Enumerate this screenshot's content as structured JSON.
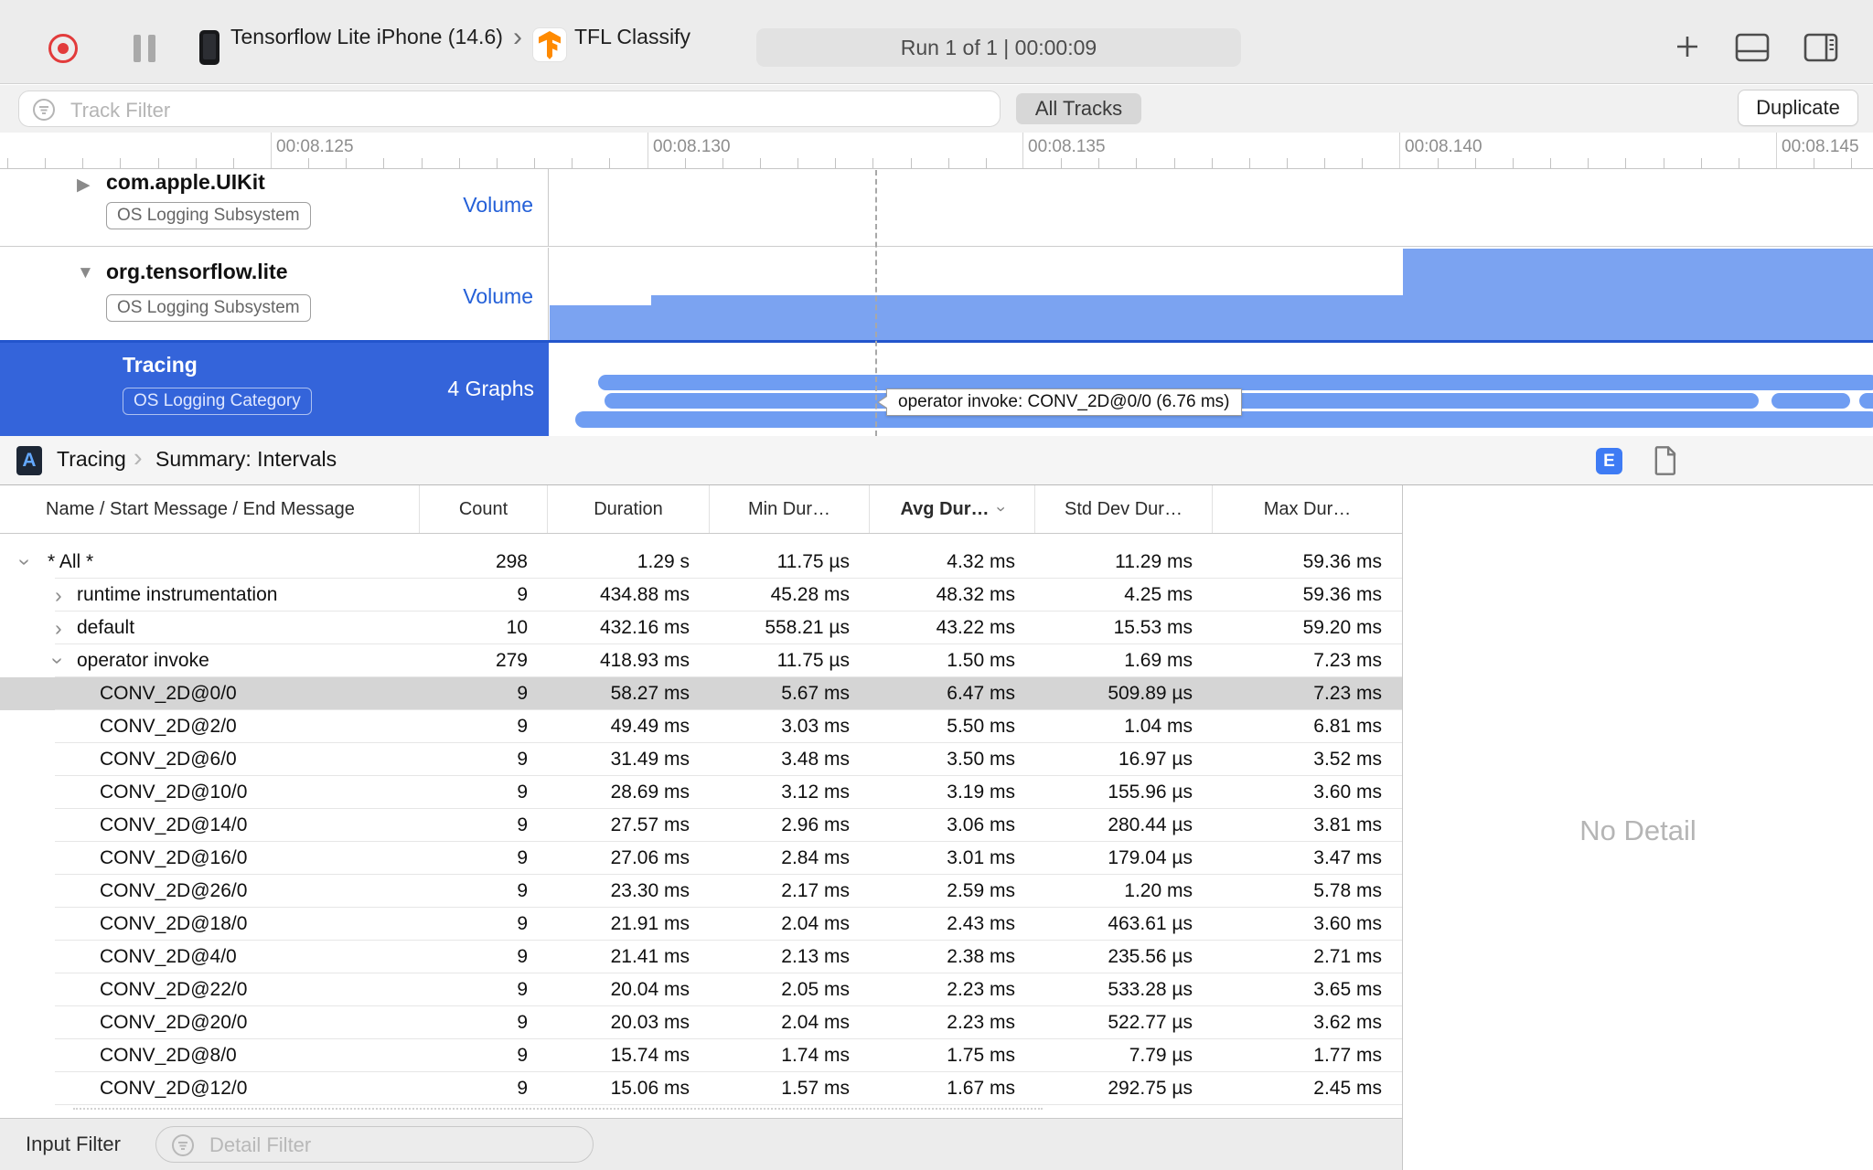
{
  "toolbar": {
    "device": "Tensorflow Lite iPhone (14.6)",
    "separator_glyph": "›",
    "target": "TFL Classify",
    "run_info": "Run 1 of 1  |  00:00:09"
  },
  "filter_bar": {
    "track_filter_placeholder": "Track Filter",
    "all_tracks_label": "All Tracks",
    "duplicate_label": "Duplicate"
  },
  "ruler": {
    "ticks": [
      "00:08.125",
      "00:08.130",
      "00:08.135",
      "00:08.140",
      "00:08.145"
    ]
  },
  "tracks": [
    {
      "name": "com.apple.UIKit",
      "badge": "OS Logging Subsystem",
      "lane_label": "Volume",
      "state": "collapsed"
    },
    {
      "name": "org.tensorflow.lite",
      "badge": "OS Logging Subsystem",
      "lane_label": "Volume",
      "state": "expanded"
    },
    {
      "name": "Tracing",
      "badge": "OS Logging Category",
      "lane_label": "4 Graphs",
      "state": "selected"
    }
  ],
  "timeline": {
    "tooltip": "operator invoke: CONV_2D@0/0 (6.76 ms)"
  },
  "colors": {
    "selection_blue": "#3464da",
    "histogram_blue": "#7ba3f1",
    "interval_blue": "#6f9df2",
    "record_red": "#e23b3b",
    "badge_blue": "#3e7bf4"
  },
  "detail": {
    "breadcrumb": [
      "Tracing",
      "Summary: Intervals"
    ],
    "breadcrumb_separator": "›",
    "inspector_badge": "E",
    "no_detail": "No Detail",
    "table": {
      "columns": [
        "Name / Start Message / End Message",
        "Count",
        "Duration",
        "Min Dur…",
        "Avg Dur…",
        "Std Dev Dur…",
        "Max Dur…"
      ],
      "sorted_column": "Avg Dur…",
      "rows": [
        {
          "name": "* All *",
          "count": "298",
          "duration": "1.29 s",
          "min": "11.75 µs",
          "avg": "4.32 ms",
          "std": "11.29 ms",
          "max": "59.36 ms",
          "level": 0,
          "disclosure": "down",
          "selected": false
        },
        {
          "name": "runtime instrumentation",
          "count": "9",
          "duration": "434.88 ms",
          "min": "45.28 ms",
          "avg": "48.32 ms",
          "std": "4.25 ms",
          "max": "59.36 ms",
          "level": 1,
          "disclosure": "right",
          "selected": false
        },
        {
          "name": "default",
          "count": "10",
          "duration": "432.16 ms",
          "min": "558.21 µs",
          "avg": "43.22 ms",
          "std": "15.53 ms",
          "max": "59.20 ms",
          "level": 1,
          "disclosure": "right",
          "selected": false
        },
        {
          "name": "operator invoke",
          "count": "279",
          "duration": "418.93 ms",
          "min": "11.75 µs",
          "avg": "1.50 ms",
          "std": "1.69 ms",
          "max": "7.23 ms",
          "level": 1,
          "disclosure": "down",
          "selected": false
        },
        {
          "name": "CONV_2D@0/0",
          "count": "9",
          "duration": "58.27 ms",
          "min": "5.67 ms",
          "avg": "6.47 ms",
          "std": "509.89 µs",
          "max": "7.23 ms",
          "level": 2,
          "disclosure": null,
          "selected": true
        },
        {
          "name": "CONV_2D@2/0",
          "count": "9",
          "duration": "49.49 ms",
          "min": "3.03 ms",
          "avg": "5.50 ms",
          "std": "1.04 ms",
          "max": "6.81 ms",
          "level": 2,
          "disclosure": null,
          "selected": false
        },
        {
          "name": "CONV_2D@6/0",
          "count": "9",
          "duration": "31.49 ms",
          "min": "3.48 ms",
          "avg": "3.50 ms",
          "std": "16.97 µs",
          "max": "3.52 ms",
          "level": 2,
          "disclosure": null,
          "selected": false
        },
        {
          "name": "CONV_2D@10/0",
          "count": "9",
          "duration": "28.69 ms",
          "min": "3.12 ms",
          "avg": "3.19 ms",
          "std": "155.96 µs",
          "max": "3.60 ms",
          "level": 2,
          "disclosure": null,
          "selected": false
        },
        {
          "name": "CONV_2D@14/0",
          "count": "9",
          "duration": "27.57 ms",
          "min": "2.96 ms",
          "avg": "3.06 ms",
          "std": "280.44 µs",
          "max": "3.81 ms",
          "level": 2,
          "disclosure": null,
          "selected": false
        },
        {
          "name": "CONV_2D@16/0",
          "count": "9",
          "duration": "27.06 ms",
          "min": "2.84 ms",
          "avg": "3.01 ms",
          "std": "179.04 µs",
          "max": "3.47 ms",
          "level": 2,
          "disclosure": null,
          "selected": false
        },
        {
          "name": "CONV_2D@26/0",
          "count": "9",
          "duration": "23.30 ms",
          "min": "2.17 ms",
          "avg": "2.59 ms",
          "std": "1.20 ms",
          "max": "5.78 ms",
          "level": 2,
          "disclosure": null,
          "selected": false
        },
        {
          "name": "CONV_2D@18/0",
          "count": "9",
          "duration": "21.91 ms",
          "min": "2.04 ms",
          "avg": "2.43 ms",
          "std": "463.61 µs",
          "max": "3.60 ms",
          "level": 2,
          "disclosure": null,
          "selected": false
        },
        {
          "name": "CONV_2D@4/0",
          "count": "9",
          "duration": "21.41 ms",
          "min": "2.13 ms",
          "avg": "2.38 ms",
          "std": "235.56 µs",
          "max": "2.71 ms",
          "level": 2,
          "disclosure": null,
          "selected": false
        },
        {
          "name": "CONV_2D@22/0",
          "count": "9",
          "duration": "20.04 ms",
          "min": "2.05 ms",
          "avg": "2.23 ms",
          "std": "533.28 µs",
          "max": "3.65 ms",
          "level": 2,
          "disclosure": null,
          "selected": false
        },
        {
          "name": "CONV_2D@20/0",
          "count": "9",
          "duration": "20.03 ms",
          "min": "2.04 ms",
          "avg": "2.23 ms",
          "std": "522.77 µs",
          "max": "3.62 ms",
          "level": 2,
          "disclosure": null,
          "selected": false
        },
        {
          "name": "CONV_2D@8/0",
          "count": "9",
          "duration": "15.74 ms",
          "min": "1.74 ms",
          "avg": "1.75 ms",
          "std": "7.79 µs",
          "max": "1.77 ms",
          "level": 2,
          "disclosure": null,
          "selected": false
        },
        {
          "name": "CONV_2D@12/0",
          "count": "9",
          "duration": "15.06 ms",
          "min": "1.57 ms",
          "avg": "1.67 ms",
          "std": "292.75 µs",
          "max": "2.45 ms",
          "level": 2,
          "disclosure": null,
          "selected": false
        }
      ]
    }
  },
  "bottom_bar": {
    "input_filter_label": "Input Filter",
    "detail_filter_placeholder": "Detail Filter"
  }
}
